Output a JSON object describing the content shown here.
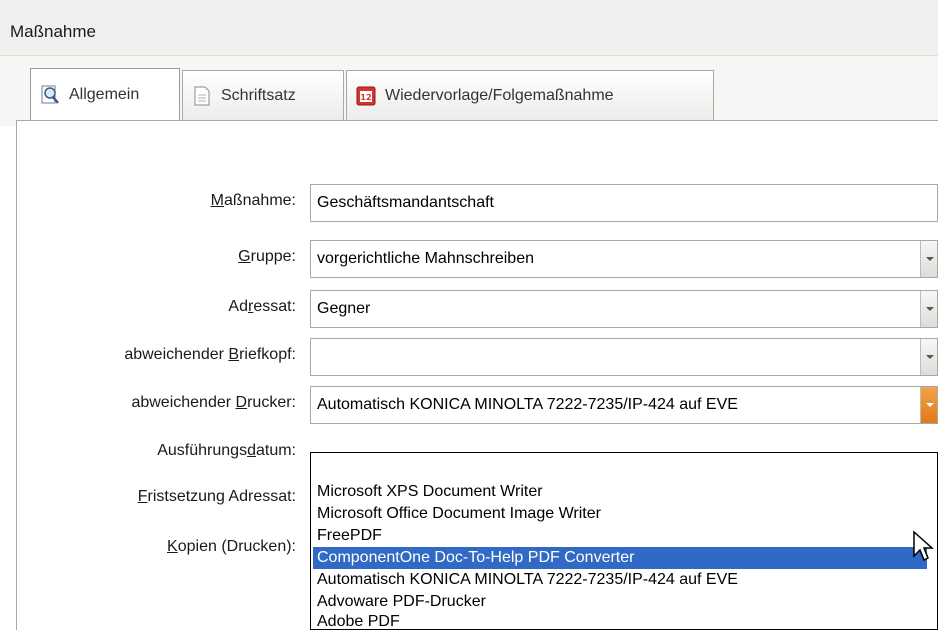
{
  "window": {
    "title": "Maßnahme"
  },
  "tabs": [
    {
      "label": "Allgemein",
      "icon": "magnifier-document-icon",
      "active": true
    },
    {
      "label": "Schriftsatz",
      "icon": "document-icon",
      "active": false
    },
    {
      "label": "Wiedervorlage/Folgemaßnahme",
      "icon": "calendar-12-icon",
      "active": false
    }
  ],
  "form": {
    "massnahme": {
      "label": "Maßnahme:",
      "value": "Geschäftsmandantschaft"
    },
    "gruppe": {
      "label": "Gruppe:",
      "value": "vorgerichtliche Mahnschreiben"
    },
    "adressat": {
      "label": "Adressat:",
      "value": "Gegner"
    },
    "briefkopf": {
      "label": "abweichender Briefkopf:",
      "value": ""
    },
    "drucker": {
      "label": "abweichender Drucker:",
      "value": "Automatisch KONICA MINOLTA 7222-7235/IP-424 auf EVE"
    },
    "ausfuehrungsdatum": {
      "label": "Ausführungsdatum:"
    },
    "fristsetzung": {
      "label": "Fristsetzung Adressat:"
    },
    "kopien": {
      "label": "Kopien (Drucken):"
    }
  },
  "dropdown": {
    "items": [
      "",
      "Microsoft XPS Document Writer",
      "Microsoft Office Document Image Writer",
      "FreePDF",
      "ComponentOne Doc-To-Help PDF Converter",
      "Automatisch KONICA MINOLTA 7222-7235/IP-424 auf EVE",
      "Advoware PDF-Drucker",
      "Adobe PDF"
    ],
    "selected_index": 4
  },
  "colors": {
    "selection": "#316ac5",
    "dropdown_button_open": "#e3791a"
  }
}
